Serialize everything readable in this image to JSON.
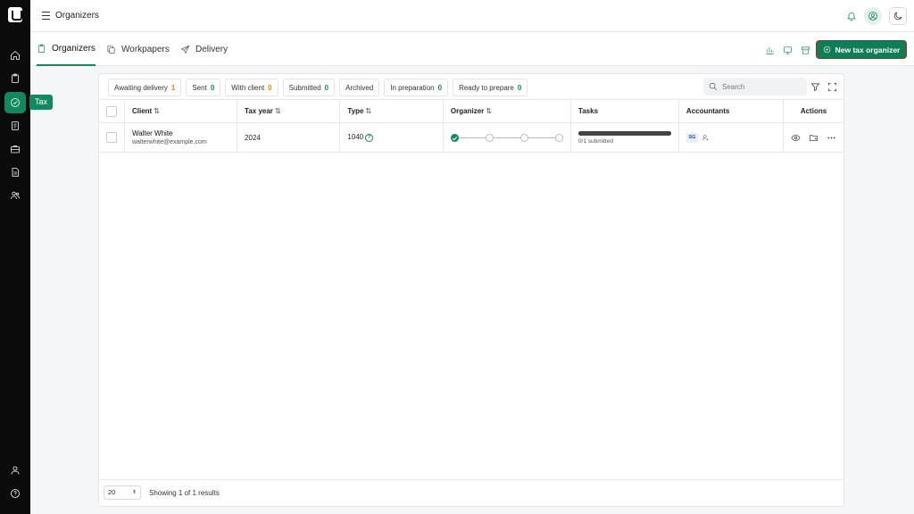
{
  "app": {
    "page_title": "Organizers",
    "tooltip": "Tax"
  },
  "nav": {
    "rail_icons": [
      "home-icon",
      "clipboard-icon",
      "tax-icon",
      "document-icon",
      "briefcase-icon",
      "file-text-icon",
      "users-icon",
      "user-icon",
      "help-icon"
    ],
    "active": "tax-icon"
  },
  "tabs": [
    {
      "label": "Organizers",
      "icon": "clipboard-icon",
      "active": true
    },
    {
      "label": "Workpapers",
      "icon": "copy-icon",
      "active": false
    },
    {
      "label": "Delivery",
      "icon": "send-icon",
      "active": false
    }
  ],
  "new_button": {
    "label": "New tax organizer"
  },
  "filters": [
    {
      "label": "Awaiting delivery",
      "count": "1",
      "color": "orange"
    },
    {
      "label": "Sent",
      "count": "0",
      "color": "green"
    },
    {
      "label": "With client",
      "count": "0",
      "color": "orange"
    },
    {
      "label": "Submitted",
      "count": "0",
      "color": "green"
    },
    {
      "label": "Archived",
      "count": "",
      "color": ""
    },
    {
      "label": "In preparation",
      "count": "0",
      "color": "green"
    },
    {
      "label": "Ready to prepare",
      "count": "0",
      "color": "green"
    }
  ],
  "search": {
    "placeholder": "Search"
  },
  "table": {
    "columns": {
      "client": "Client",
      "tax_year": "Tax year",
      "type": "Type",
      "organizer": "Organizer",
      "tasks": "Tasks",
      "accountants": "Accountants",
      "actions": "Actions"
    },
    "rows": [
      {
        "client_name": "Walter White",
        "client_email": "walterwhite@example.com",
        "tax_year": "2024",
        "type": "1040",
        "organizer_steps_done": 1,
        "organizer_steps_total": 4,
        "tasks_progress": 1.0,
        "tasks_text": "0/1 submitted",
        "accountant_initials": "SG"
      }
    ]
  },
  "footer": {
    "page_size": "20",
    "showing": "Showing 1 of 1 results"
  },
  "colors": {
    "accent": "#0f8a5f",
    "rail": "#0b0b0b",
    "pending": "#e08a00"
  }
}
